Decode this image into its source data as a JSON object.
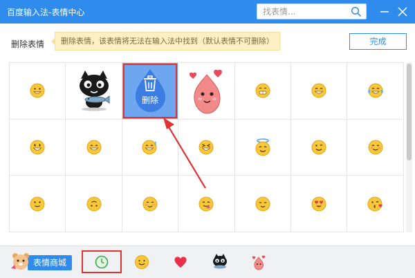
{
  "window": {
    "title": "百度输入法-表情中心"
  },
  "search": {
    "placeholder": "找表情..."
  },
  "header": {
    "delete_label": "删除表情",
    "tip": "删除表情，该表情将无法在输入法中找到（默认表情不可删除）",
    "done_button": "完成"
  },
  "grid": {
    "selected_index": 2,
    "selected_action": "删除",
    "emojis": [
      {
        "icon": "grin-emoji-icon"
      },
      {
        "icon": "black-cat-with-fish-sticker-icon"
      },
      {
        "icon": "blue-water-drop-sticker-icon"
      },
      {
        "icon": "pink-peach-hearts-sticker-icon"
      },
      {
        "icon": "grimace-emoji-icon"
      },
      {
        "icon": "teeth-grin-emoji-icon"
      },
      {
        "icon": "crying-laughing-emoji-icon"
      },
      {
        "icon": "big-smile-emoji-icon"
      },
      {
        "icon": "laughing-emoji-icon"
      },
      {
        "icon": "sweat-smile-emoji-icon"
      },
      {
        "icon": "squint-laugh-emoji-icon"
      },
      {
        "icon": "halo-angel-emoji-icon"
      },
      {
        "icon": "wink-emoji-icon"
      },
      {
        "icon": "blush-smile-emoji-icon"
      },
      {
        "icon": "slight-smile-emoji-icon"
      },
      {
        "icon": "upside-down-smile-emoji-icon"
      },
      {
        "icon": "relaxed-smile-emoji-icon"
      },
      {
        "icon": "yum-tongue-emoji-icon"
      },
      {
        "icon": "relieved-emoji-icon"
      },
      {
        "icon": "heart-eyes-emoji-icon"
      },
      {
        "icon": "kiss-heart-emoji-icon"
      }
    ]
  },
  "bottom": {
    "mall_label": "表情商城",
    "tabs": [
      {
        "icon": "clock-icon",
        "selected": true
      },
      {
        "icon": "smiley-icon",
        "selected": false
      },
      {
        "icon": "heart-icon",
        "selected": false
      },
      {
        "icon": "cat-sticker-icon",
        "selected": false
      },
      {
        "icon": "peach-sticker-icon",
        "selected": false
      }
    ]
  },
  "colors": {
    "accent": "#2f8cec",
    "highlight_red": "#e03232",
    "tip_bg": "#fdf0c4"
  }
}
